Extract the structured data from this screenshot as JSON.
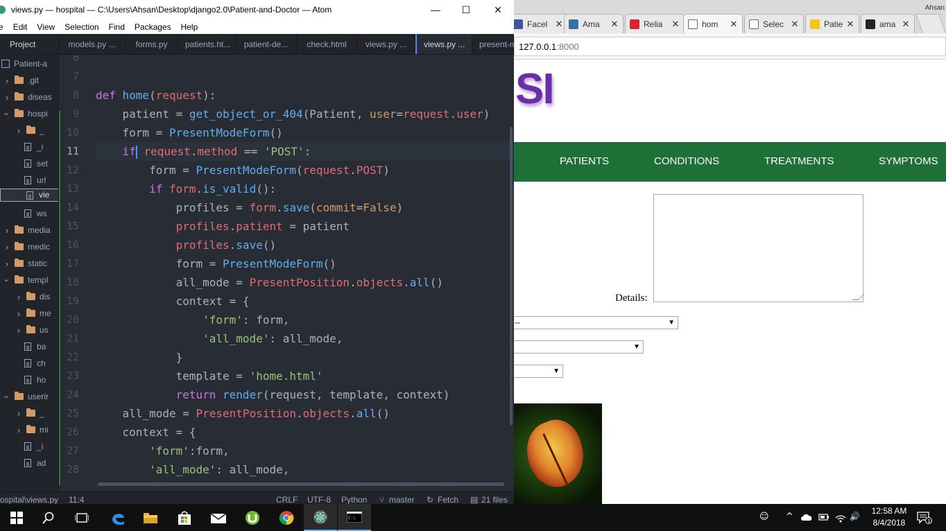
{
  "atom": {
    "window_title": "views.py — hospital — C:\\Users\\Ahsan\\Desktop\\django2.0\\Patient-and-Doctor — Atom",
    "controls": {
      "minimize": "—",
      "maximize": "☐",
      "close": "✕"
    },
    "menu": [
      "e",
      "Edit",
      "View",
      "Selection",
      "Find",
      "Packages",
      "Help"
    ],
    "sidebar": {
      "header": "Project",
      "items": [
        {
          "label": "Patient-a",
          "type": "book",
          "depth": 0,
          "expanded": true
        },
        {
          "label": ".git",
          "type": "folder",
          "depth": 1,
          "expanded": false
        },
        {
          "label": "diseas",
          "type": "folder",
          "depth": 1,
          "expanded": false
        },
        {
          "label": "hospi",
          "type": "folder",
          "depth": 1,
          "expanded": true
        },
        {
          "label": "_",
          "type": "folder",
          "depth": 2,
          "expanded": false
        },
        {
          "label": "_i",
          "type": "file",
          "depth": 2
        },
        {
          "label": "set",
          "type": "file",
          "depth": 2
        },
        {
          "label": "url",
          "type": "file",
          "depth": 2
        },
        {
          "label": "vie",
          "type": "file",
          "depth": 2,
          "selected": true
        },
        {
          "label": "ws",
          "type": "file",
          "depth": 2
        },
        {
          "label": "media",
          "type": "folder",
          "depth": 1,
          "expanded": false
        },
        {
          "label": "medic",
          "type": "folder",
          "depth": 1,
          "expanded": false
        },
        {
          "label": "static",
          "type": "folder",
          "depth": 1,
          "expanded": false
        },
        {
          "label": "templ",
          "type": "folder",
          "depth": 1,
          "expanded": true
        },
        {
          "label": "dis",
          "type": "folder",
          "depth": 2,
          "expanded": false
        },
        {
          "label": "me",
          "type": "folder",
          "depth": 2,
          "expanded": false
        },
        {
          "label": "us",
          "type": "folder",
          "depth": 2,
          "expanded": false
        },
        {
          "label": "ba",
          "type": "file",
          "depth": 2
        },
        {
          "label": "ch",
          "type": "file",
          "depth": 2
        },
        {
          "label": "ho",
          "type": "file",
          "depth": 2
        },
        {
          "label": "userir",
          "type": "folder",
          "depth": 1,
          "expanded": true
        },
        {
          "label": "_",
          "type": "folder",
          "depth": 2,
          "expanded": false
        },
        {
          "label": "mi",
          "type": "folder",
          "depth": 2,
          "expanded": false
        },
        {
          "label": "_i",
          "type": "file",
          "depth": 2
        },
        {
          "label": "ad",
          "type": "file",
          "depth": 2
        }
      ]
    },
    "tabs": [
      "models.py ...",
      "forms.py",
      "patients.ht...",
      "patient-de...",
      "check.html",
      "views.py ...",
      "views.py ...",
      "present-m"
    ],
    "active_tab_index": 6,
    "current_line": 11,
    "code_lines": [
      {
        "n": "6",
        "t": [
          [
            "p",
            ""
          ]
        ]
      },
      {
        "n": "7",
        "t": [
          [
            "p",
            ""
          ]
        ]
      },
      {
        "n": "8",
        "t": [
          [
            "k",
            "def "
          ],
          [
            "f",
            "home"
          ],
          [
            "p",
            "("
          ],
          [
            "v",
            "request"
          ],
          [
            "p",
            "):"
          ]
        ]
      },
      {
        "n": "9",
        "t": [
          [
            "p",
            "    patient = "
          ],
          [
            "f",
            "get_object_or_404"
          ],
          [
            "p",
            "(Patient, "
          ],
          [
            "n",
            "user"
          ],
          [
            "p",
            "="
          ],
          [
            "v",
            "request"
          ],
          [
            "p",
            "."
          ],
          [
            "v",
            "user"
          ],
          [
            "p",
            ")"
          ]
        ]
      },
      {
        "n": "10",
        "t": [
          [
            "p",
            "    form = "
          ],
          [
            "f",
            "PresentModeForm"
          ],
          [
            "p",
            "()"
          ]
        ]
      },
      {
        "n": "11",
        "t": [
          [
            "p",
            "    "
          ],
          [
            "k",
            "if"
          ],
          [
            "cursor",
            ""
          ],
          [
            "p",
            " "
          ],
          [
            "v",
            "request"
          ],
          [
            "p",
            "."
          ],
          [
            "v",
            "method"
          ],
          [
            "p",
            " == "
          ],
          [
            "s",
            "'POST'"
          ],
          [
            "p",
            ":"
          ]
        ]
      },
      {
        "n": "12",
        "t": [
          [
            "p",
            "        form = "
          ],
          [
            "f",
            "PresentModeForm"
          ],
          [
            "p",
            "("
          ],
          [
            "v",
            "request"
          ],
          [
            "p",
            "."
          ],
          [
            "v",
            "POST"
          ],
          [
            "p",
            ")"
          ]
        ]
      },
      {
        "n": "13",
        "t": [
          [
            "p",
            "        "
          ],
          [
            "k",
            "if "
          ],
          [
            "v",
            "form"
          ],
          [
            "p",
            "."
          ],
          [
            "f",
            "is_valid"
          ],
          [
            "p",
            "():"
          ]
        ]
      },
      {
        "n": "14",
        "t": [
          [
            "p",
            "            profiles = "
          ],
          [
            "v",
            "form"
          ],
          [
            "p",
            "."
          ],
          [
            "f",
            "save"
          ],
          [
            "p",
            "("
          ],
          [
            "n",
            "commit"
          ],
          [
            "p",
            "="
          ],
          [
            "n",
            "False"
          ],
          [
            "p",
            ")"
          ]
        ]
      },
      {
        "n": "15",
        "t": [
          [
            "p",
            "            "
          ],
          [
            "v",
            "profiles"
          ],
          [
            "p",
            "."
          ],
          [
            "v",
            "patient"
          ],
          [
            "p",
            " = patient"
          ]
        ]
      },
      {
        "n": "16",
        "t": [
          [
            "p",
            "            "
          ],
          [
            "v",
            "profiles"
          ],
          [
            "p",
            "."
          ],
          [
            "f",
            "save"
          ],
          [
            "p",
            "()"
          ]
        ]
      },
      {
        "n": "17",
        "t": [
          [
            "p",
            "            form = "
          ],
          [
            "f",
            "PresentModeForm"
          ],
          [
            "p",
            "()"
          ]
        ]
      },
      {
        "n": "18",
        "t": [
          [
            "p",
            "            all_mode = "
          ],
          [
            "v",
            "PresentPosition"
          ],
          [
            "p",
            "."
          ],
          [
            "v",
            "objects"
          ],
          [
            "p",
            "."
          ],
          [
            "f",
            "all"
          ],
          [
            "p",
            "()"
          ]
        ]
      },
      {
        "n": "19",
        "t": [
          [
            "p",
            "            context = {"
          ]
        ]
      },
      {
        "n": "20",
        "t": [
          [
            "p",
            "                "
          ],
          [
            "s",
            "'form'"
          ],
          [
            "p",
            ": form,"
          ]
        ]
      },
      {
        "n": "21",
        "t": [
          [
            "p",
            "                "
          ],
          [
            "s",
            "'all_mode'"
          ],
          [
            "p",
            ": all_mode,"
          ]
        ]
      },
      {
        "n": "22",
        "t": [
          [
            "p",
            "            }"
          ]
        ]
      },
      {
        "n": "23",
        "t": [
          [
            "p",
            "            template = "
          ],
          [
            "s",
            "'home.html'"
          ]
        ]
      },
      {
        "n": "24",
        "t": [
          [
            "p",
            "            "
          ],
          [
            "k",
            "return "
          ],
          [
            "f",
            "render"
          ],
          [
            "p",
            "(request, template, context)"
          ]
        ]
      },
      {
        "n": "25",
        "t": [
          [
            "p",
            "    all_mode = "
          ],
          [
            "v",
            "PresentPosition"
          ],
          [
            "p",
            "."
          ],
          [
            "v",
            "objects"
          ],
          [
            "p",
            "."
          ],
          [
            "f",
            "all"
          ],
          [
            "p",
            "()"
          ]
        ]
      },
      {
        "n": "26",
        "t": [
          [
            "p",
            "    context = {"
          ]
        ]
      },
      {
        "n": "27",
        "t": [
          [
            "p",
            "        "
          ],
          [
            "s",
            "'form'"
          ],
          [
            "p",
            ":form,"
          ]
        ]
      },
      {
        "n": "28",
        "t": [
          [
            "p",
            "        "
          ],
          [
            "s",
            "'all_mode'"
          ],
          [
            "p",
            ": all_mode,"
          ]
        ]
      }
    ],
    "status": {
      "path": "ospital\\views.py",
      "position": "11:4",
      "line_ending": "CRLF",
      "encoding": "UTF-8",
      "grammar": "Python",
      "branch": "master",
      "fetch": "Fetch",
      "files": "21 files"
    }
  },
  "chrome": {
    "user": "Ahsan",
    "tabs": [
      {
        "label": "Facel",
        "fav_color": "#3b5998"
      },
      {
        "label": "Ama",
        "fav_color": "#3572a5"
      },
      {
        "label": "Relia",
        "fav_color": "#d9232d"
      },
      {
        "label": "hom",
        "fav_color": "#ffffff",
        "active": true
      },
      {
        "label": "Selec",
        "fav_color": "#ffffff"
      },
      {
        "label": "Patie",
        "fav_color": "#f5c518"
      },
      {
        "label": "ama",
        "fav_color": "#222222"
      }
    ],
    "close_glyph": "✕",
    "url_host": "127.0.0.1",
    "url_port": ":8000",
    "page": {
      "logo_text": "SI",
      "nav": [
        "PATIENTS",
        "CONDITIONS",
        "TREATMENTS",
        "SYMPTOMS"
      ],
      "details_label": "Details:",
      "select1_value": "--",
      "select_arrow": "▼"
    }
  },
  "taskbar": {
    "time": "12:58 AM",
    "date": "8/4/2018",
    "notification_count": "1",
    "tray_glyphs": {
      "people": "☺",
      "chevron": "^",
      "volume": "🔊"
    }
  }
}
